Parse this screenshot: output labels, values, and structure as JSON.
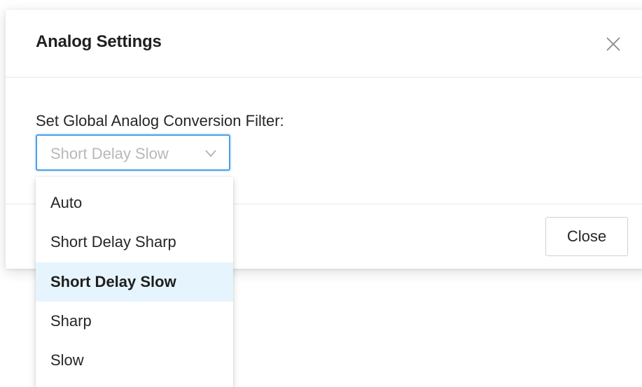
{
  "dialog": {
    "title": "Analog Settings",
    "close_icon": "close-icon",
    "filter_label": "Set Global Analog Conversion Filter:",
    "select": {
      "value": "Short Delay Slow",
      "icon": "chevron-down-icon"
    },
    "close_button_label": "Close"
  },
  "dropdown": {
    "options": [
      {
        "label": "Auto",
        "selected": false
      },
      {
        "label": "Short Delay Sharp",
        "selected": false
      },
      {
        "label": "Short Delay Slow",
        "selected": true
      },
      {
        "label": "Sharp",
        "selected": false
      },
      {
        "label": "Slow",
        "selected": false
      }
    ]
  },
  "colors": {
    "focus_border": "#4a9ee8",
    "selected_option_bg": "#e6f5fd",
    "placeholder_text": "#b8b8b8"
  }
}
